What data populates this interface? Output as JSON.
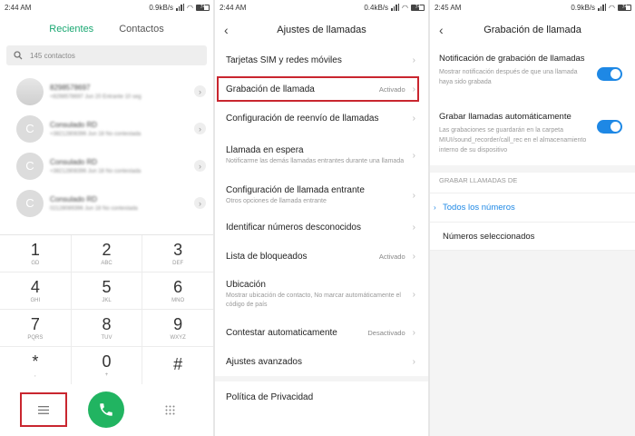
{
  "screen1": {
    "status": {
      "time": "2:44 AM",
      "speed": "0.9kB/s",
      "battery": "74"
    },
    "tabs": [
      {
        "label": "Recientes"
      },
      {
        "label": "Contactos"
      }
    ],
    "search": {
      "placeholder": "145 contactos"
    },
    "contacts": [
      {
        "initial": "",
        "name": "8298578697",
        "detail": "+8298578697 Jun 20 Entrante 10 seg"
      },
      {
        "initial": "C",
        "name": "Consulado RD",
        "detail": "+38212808396 Jun 18 No contestada"
      },
      {
        "initial": "C",
        "name": "Consulado RD",
        "detail": "+38212808396 Jun 18 No contestada"
      },
      {
        "initial": "C",
        "name": "Consulado RD",
        "detail": "02128089396 Jun 18 No contestada"
      }
    ],
    "keypad": [
      [
        {
          "digit": "1",
          "letters": "GD"
        },
        {
          "digit": "2",
          "letters": "ABC"
        },
        {
          "digit": "3",
          "letters": "DEF"
        }
      ],
      [
        {
          "digit": "4",
          "letters": "GHI"
        },
        {
          "digit": "5",
          "letters": "JKL"
        },
        {
          "digit": "6",
          "letters": "MNO"
        }
      ],
      [
        {
          "digit": "7",
          "letters": "PQRS"
        },
        {
          "digit": "8",
          "letters": "TUV"
        },
        {
          "digit": "9",
          "letters": "WXYZ"
        }
      ],
      [
        {
          "digit": "*",
          "letters": ","
        },
        {
          "digit": "0",
          "letters": "+"
        },
        {
          "digit": "#",
          "letters": ""
        }
      ]
    ],
    "colors": {
      "accent": "#1aa872",
      "call": "#21b461",
      "highlight": "#c9262f"
    }
  },
  "screen2": {
    "status": {
      "time": "2:44 AM",
      "speed": "0.4kB/s",
      "battery": "74"
    },
    "title": "Ajustes de llamadas",
    "items": [
      {
        "label": "Tarjetas SIM y redes móviles",
        "sub": "",
        "value": ""
      },
      {
        "label": "Grabación de llamada",
        "sub": "",
        "value": "Activado"
      },
      {
        "label": "Configuración de reenvío de llamadas",
        "sub": "",
        "value": ""
      },
      {
        "label": "Llamada en espera",
        "sub": "Notificarme las demás llamadas entrantes durante una llamada",
        "value": ""
      },
      {
        "label": "Configuración de llamada entrante",
        "sub": "Otros opciones de llamada entrante",
        "value": ""
      },
      {
        "label": "Identificar números desconocidos",
        "sub": "",
        "value": ""
      },
      {
        "label": "Lista de bloqueados",
        "sub": "",
        "value": "Activado"
      },
      {
        "label": "Ubicación",
        "sub": "Mostrar ubicación de contacto, No marcar automáticamente el código de país",
        "value": ""
      },
      {
        "label": "Contestar automaticamente",
        "sub": "",
        "value": "Desactivado"
      },
      {
        "label": "Ajustes avanzados",
        "sub": "",
        "value": ""
      },
      {
        "label": "Política de Privacidad",
        "sub": "",
        "value": ""
      }
    ]
  },
  "screen3": {
    "status": {
      "time": "2:45 AM",
      "speed": "0.9kB/s",
      "battery": "74"
    },
    "title": "Grabación de llamada",
    "toggles": [
      {
        "label": "Notificación de grabación de llamadas",
        "sub": "Mostrar notificación después de que una llamada haya sido grabada",
        "on": true
      },
      {
        "label": "Grabar llamadas automáticamente",
        "sub": "Las grabaciones se guardarán en la carpeta MIUI/sound_recorder/call_rec en el almacenamiento interno de su dispositivo",
        "on": true
      }
    ],
    "section_header": "GRABAR LLAMADAS DE",
    "options": [
      {
        "label": "Todos los números",
        "selected": true
      },
      {
        "label": "Números seleccionados",
        "selected": false
      }
    ],
    "colors": {
      "toggle_on": "#1e88e5"
    }
  }
}
